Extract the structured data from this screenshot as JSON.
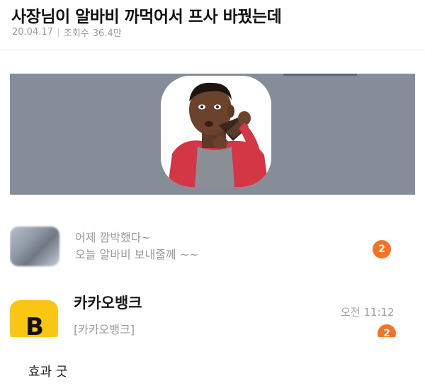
{
  "post": {
    "title": "사장님이 알바비 까먹어서 프사 바꿨는데",
    "date": "20.04.17",
    "views_label": "조회수",
    "views_value": "36.4만"
  },
  "screenshot": {
    "notification_1": {
      "line1": "어제 깜박했다~",
      "line2": "오늘 알바비 보내줄께 ~~",
      "badge": "2"
    },
    "notification_2": {
      "app_icon_letter": "B",
      "app_name": "카카오뱅크",
      "subtitle": "[카카오뱅크]",
      "time": "오전 11:12",
      "badge": "2"
    }
  },
  "comment": {
    "text": "효과 굿"
  },
  "colors": {
    "banner": "#858d98",
    "badge": "#f57325",
    "kakaobank_yellow": "#f9c713"
  }
}
